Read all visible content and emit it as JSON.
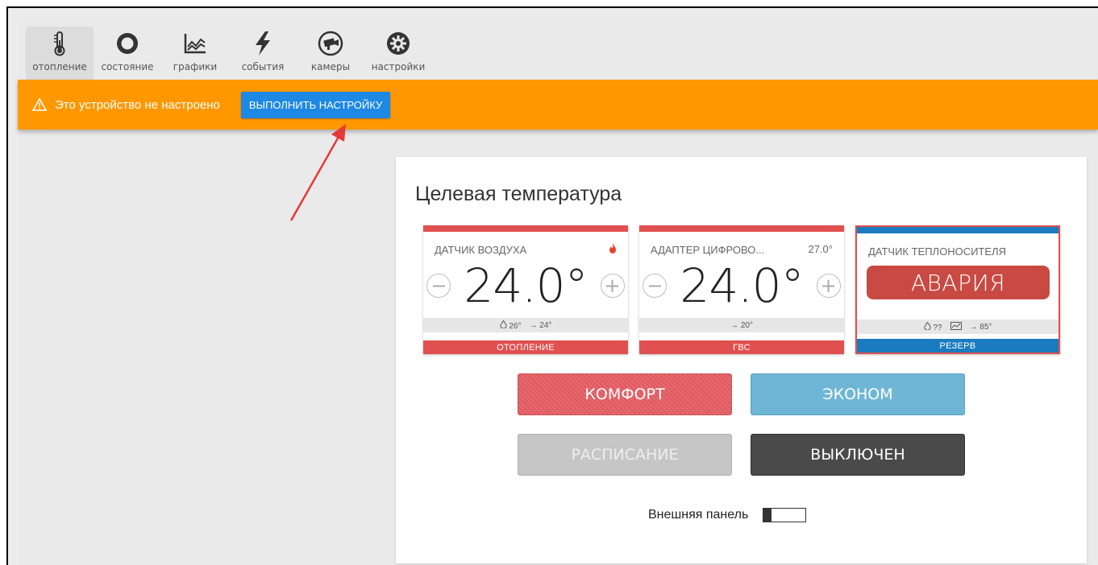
{
  "toolbar": {
    "items": [
      {
        "label": "отопление",
        "icon": "thermometer-icon",
        "active": true
      },
      {
        "label": "состояние",
        "icon": "circle-status-icon",
        "active": false
      },
      {
        "label": "графики",
        "icon": "chart-icon",
        "active": false
      },
      {
        "label": "события",
        "icon": "lightning-icon",
        "active": false
      },
      {
        "label": "камеры",
        "icon": "camera-icon",
        "active": false
      },
      {
        "label": "настройки",
        "icon": "gear-icon",
        "active": false
      }
    ]
  },
  "banner": {
    "message": "Это устройство не настроено",
    "button_label": "ВЫПОЛНИТЬ НАСТРОЙКУ",
    "color": "#ff9800",
    "button_color": "#1e88e5"
  },
  "panel": {
    "title": "Целевая температура",
    "cards": [
      {
        "name": "ДАТЧИК ВОЗДУХА",
        "extra_icon": "flame-icon",
        "temperature": "24.0°",
        "info": [
          "26°",
          "→ 24°"
        ],
        "mode": "ОТОПЛЕНИЕ",
        "color": "#e05050"
      },
      {
        "name": "АДАПТЕР ЦИФРОВО...",
        "extra": "27.0°",
        "temperature": "24.0°",
        "info": [
          "→ 20°"
        ],
        "mode": "ГВС",
        "color": "#e05050"
      },
      {
        "name": "ДАТЧИК ТЕПЛОНОСИТЕЛЯ",
        "alarm": "АВАРИЯ",
        "info": [
          "??",
          "→ 85°"
        ],
        "mode": "РЕЗЕРВ",
        "color": "#1a7bbf"
      }
    ],
    "modes": {
      "comfort": "КОМФОРТ",
      "econom": "ЭКОНОМ",
      "schedule": "РАСПИСАНИЕ",
      "off": "ВЫКЛЮЧЕН"
    },
    "external_panel": {
      "label": "Внешняя панель",
      "enabled": false
    }
  }
}
